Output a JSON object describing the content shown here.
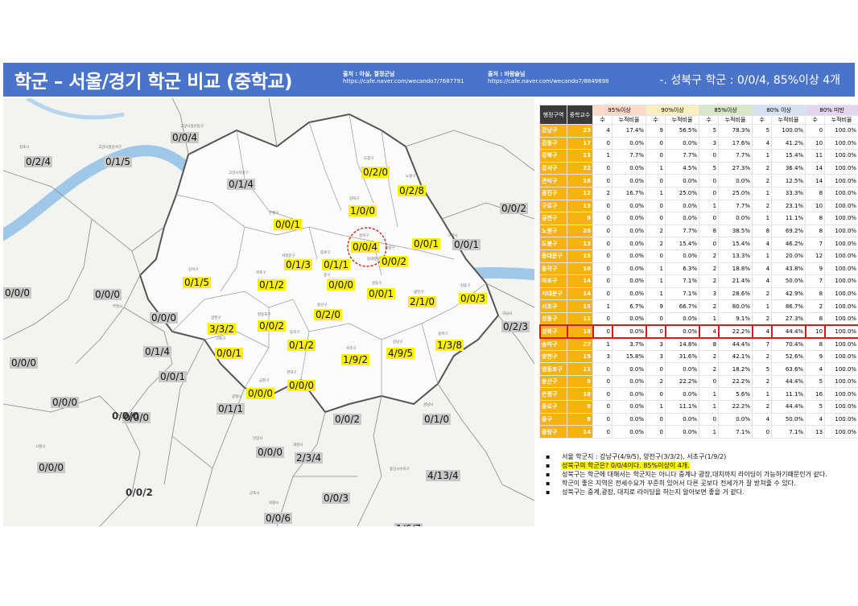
{
  "header": {
    "title": "학군 – 서울/경기 학군 비교 (중학교)",
    "source1_title": "출처 : 아실, 절정군님",
    "source1_url": "https://cafe.naver.com/wecando7/7687791",
    "source2_title": "출처 : 바람술님",
    "source2_url": "https://cafe.naver.com/wecando7/8849898",
    "summary": "-. 성북구 학군 : 0/0/4, 85%이상 4개"
  },
  "colors": {
    "header_bg": "#4a74c9",
    "district_cell": "#f6b20d",
    "label_yellow": "#fff200",
    "label_gray": "#c9c9c9",
    "highlight": "#d41a1a"
  },
  "map": {
    "labels": [
      {
        "text": "0/0/4",
        "style": "g"
      },
      {
        "text": "0/2/4",
        "style": "g"
      },
      {
        "text": "0/1/5",
        "style": "g"
      },
      {
        "text": "0/1/4",
        "style": "g"
      },
      {
        "text": "0/2/0",
        "style": "y"
      },
      {
        "text": "0/2/8",
        "style": "y"
      },
      {
        "text": "1/0/0",
        "style": "y"
      },
      {
        "text": "0/0/2",
        "style": "g"
      },
      {
        "text": "0/0/1",
        "style": "y"
      },
      {
        "text": "0/0/4",
        "style": "y"
      },
      {
        "text": "0/0/1",
        "style": "y"
      },
      {
        "text": "0/0/1",
        "style": "g"
      },
      {
        "text": "0/1/3",
        "style": "y"
      },
      {
        "text": "0/1/1",
        "style": "y"
      },
      {
        "text": "0/0/2",
        "style": "y"
      },
      {
        "text": "0/1/5",
        "style": "y"
      },
      {
        "text": "0/1/2",
        "style": "y"
      },
      {
        "text": "0/0/0",
        "style": "y"
      },
      {
        "text": "0/0/0",
        "style": "g"
      },
      {
        "text": "0/0/0",
        "style": "g"
      },
      {
        "text": "0/0/1",
        "style": "y"
      },
      {
        "text": "2/1/0",
        "style": "y"
      },
      {
        "text": "0/0/3",
        "style": "y"
      },
      {
        "text": "0/0/0",
        "style": "g"
      },
      {
        "text": "3/3/2",
        "style": "y"
      },
      {
        "text": "0/0/2",
        "style": "y"
      },
      {
        "text": "0/2/0",
        "style": "y"
      },
      {
        "text": "0/2/3",
        "style": "g"
      },
      {
        "text": "0/1/4",
        "style": "g"
      },
      {
        "text": "0/0/1",
        "style": "y"
      },
      {
        "text": "0/1/2",
        "style": "y"
      },
      {
        "text": "1/9/2",
        "style": "y"
      },
      {
        "text": "4/9/5",
        "style": "y"
      },
      {
        "text": "1/3/8",
        "style": "y"
      },
      {
        "text": "0/0/0",
        "style": "g"
      },
      {
        "text": "0/0/1",
        "style": "g"
      },
      {
        "text": "0/0/0",
        "style": "y"
      },
      {
        "text": "0/0/0",
        "style": "y"
      },
      {
        "text": "0/0/0",
        "style": "g"
      },
      {
        "text": "0/1/1",
        "style": "g"
      },
      {
        "text": "0/0/0",
        "style": "g"
      },
      {
        "text": "0/0/2",
        "style": "g"
      },
      {
        "text": "0/1/0",
        "style": "g"
      },
      {
        "text": "0/0/0",
        "style": "g"
      },
      {
        "text": "0/0/0",
        "style": "g"
      },
      {
        "text": "2/3/4",
        "style": "g"
      },
      {
        "text": "0/0/0",
        "style": "w"
      },
      {
        "text": "4/13/4",
        "style": "g"
      },
      {
        "text": "0/0/2",
        "style": "w"
      },
      {
        "text": "0/0/3",
        "style": "g"
      },
      {
        "text": "0/0/6",
        "style": "g"
      },
      {
        "text": "1/6/7",
        "style": "g"
      }
    ],
    "small_names": [
      "고양시일산동구",
      "김포시",
      "고양시일산서구",
      "고양시덕양구",
      "도봉구",
      "노원구",
      "강북구",
      "은평구",
      "성북구",
      "중랑구",
      "구리시",
      "서대문구",
      "종로구",
      "동대문구",
      "강서구",
      "마포구",
      "중구",
      "성동구",
      "광진구",
      "부천시",
      "양천구",
      "영등포구",
      "용산구",
      "강동구",
      "하남시",
      "구로구",
      "동작구",
      "서초구",
      "강남구",
      "송파구",
      "금천구",
      "관악구",
      "광명시",
      "시흥시",
      "안양시",
      "과천시",
      "성남시",
      "의왕시",
      "군포시",
      "용인시수지구"
    ]
  },
  "table": {
    "col_district": "행정구역",
    "col_schools": "중학교수",
    "groups": [
      "95%이상",
      "90%이상",
      "85%이상",
      "80% 이상",
      "80% 미만"
    ],
    "sub_count": "수",
    "sub_ratio": "누적비율",
    "rows": [
      {
        "d": "강남구",
        "n": "23",
        "v": [
          "4",
          "17.4%",
          "9",
          "56.5%",
          "5",
          "78.3%",
          "5",
          "100.0%",
          "0",
          "100.0%"
        ]
      },
      {
        "d": "강동구",
        "n": "17",
        "v": [
          "0",
          "0.0%",
          "0",
          "0.0%",
          "3",
          "17.6%",
          "4",
          "41.2%",
          "10",
          "100.0%"
        ]
      },
      {
        "d": "강북구",
        "n": "13",
        "v": [
          "1",
          "7.7%",
          "0",
          "7.7%",
          "0",
          "7.7%",
          "1",
          "15.4%",
          "11",
          "100.0%"
        ]
      },
      {
        "d": "강서구",
        "n": "22",
        "v": [
          "0",
          "0.0%",
          "1",
          "4.5%",
          "5",
          "27.3%",
          "2",
          "36.4%",
          "14",
          "100.0%"
        ]
      },
      {
        "d": "관악구",
        "n": "16",
        "v": [
          "0",
          "0.0%",
          "0",
          "0.0%",
          "0",
          "0.0%",
          "2",
          "12.5%",
          "14",
          "100.0%"
        ]
      },
      {
        "d": "광진구",
        "n": "12",
        "v": [
          "2",
          "16.7%",
          "1",
          "25.0%",
          "0",
          "25.0%",
          "1",
          "33.3%",
          "8",
          "100.0%"
        ]
      },
      {
        "d": "구로구",
        "n": "13",
        "v": [
          "0",
          "0.0%",
          "0",
          "0.0%",
          "1",
          "7.7%",
          "2",
          "23.1%",
          "10",
          "100.0%"
        ]
      },
      {
        "d": "금천구",
        "n": "9",
        "v": [
          "0",
          "0.0%",
          "0",
          "0.0%",
          "0",
          "0.0%",
          "1",
          "11.1%",
          "8",
          "100.0%"
        ]
      },
      {
        "d": "노원구",
        "n": "26",
        "v": [
          "0",
          "0.0%",
          "2",
          "7.7%",
          "8",
          "38.5%",
          "8",
          "69.2%",
          "8",
          "100.0%"
        ]
      },
      {
        "d": "도봉구",
        "n": "13",
        "v": [
          "0",
          "0.0%",
          "2",
          "15.4%",
          "0",
          "15.4%",
          "4",
          "46.2%",
          "7",
          "100.0%"
        ]
      },
      {
        "d": "동대문구",
        "n": "15",
        "v": [
          "0",
          "0.0%",
          "0",
          "0.0%",
          "2",
          "13.3%",
          "1",
          "20.0%",
          "12",
          "100.0%"
        ]
      },
      {
        "d": "동작구",
        "n": "16",
        "v": [
          "0",
          "0.0%",
          "1",
          "6.3%",
          "2",
          "18.8%",
          "4",
          "43.8%",
          "9",
          "100.0%"
        ]
      },
      {
        "d": "마포구",
        "n": "14",
        "v": [
          "0",
          "0.0%",
          "1",
          "7.1%",
          "2",
          "21.4%",
          "4",
          "50.0%",
          "7",
          "100.0%"
        ]
      },
      {
        "d": "서대문구",
        "n": "14",
        "v": [
          "0",
          "0.0%",
          "1",
          "7.1%",
          "3",
          "28.6%",
          "2",
          "42.9%",
          "8",
          "100.0%"
        ]
      },
      {
        "d": "서초구",
        "n": "15",
        "v": [
          "1",
          "6.7%",
          "9",
          "66.7%",
          "2",
          "80.0%",
          "1",
          "86.7%",
          "2",
          "100.0%"
        ]
      },
      {
        "d": "성동구",
        "n": "11",
        "v": [
          "0",
          "0.0%",
          "0",
          "0.0%",
          "1",
          "9.1%",
          "2",
          "27.3%",
          "8",
          "100.0%"
        ]
      },
      {
        "d": "성북구",
        "n": "18",
        "v": [
          "0",
          "0.0%",
          "0",
          "0.0%",
          "4",
          "22.2%",
          "4",
          "44.4%",
          "10",
          "100.0%"
        ],
        "highlight": true
      },
      {
        "d": "송파구",
        "n": "27",
        "v": [
          "1",
          "3.7%",
          "3",
          "14.8%",
          "8",
          "44.4%",
          "7",
          "70.4%",
          "8",
          "100.0%"
        ]
      },
      {
        "d": "양천구",
        "n": "19",
        "v": [
          "3",
          "15.8%",
          "3",
          "31.6%",
          "2",
          "42.1%",
          "2",
          "52.6%",
          "9",
          "100.0%"
        ]
      },
      {
        "d": "영등포구",
        "n": "11",
        "v": [
          "0",
          "0.0%",
          "0",
          "0.0%",
          "2",
          "18.2%",
          "5",
          "63.6%",
          "4",
          "100.0%"
        ]
      },
      {
        "d": "용산구",
        "n": "9",
        "v": [
          "0",
          "0.0%",
          "2",
          "22.2%",
          "0",
          "22.2%",
          "2",
          "44.4%",
          "5",
          "100.0%"
        ]
      },
      {
        "d": "은평구",
        "n": "18",
        "v": [
          "0",
          "0.0%",
          "0",
          "0.0%",
          "1",
          "5.6%",
          "1",
          "11.1%",
          "16",
          "100.0%"
        ]
      },
      {
        "d": "종로구",
        "n": "9",
        "v": [
          "0",
          "0.0%",
          "1",
          "11.1%",
          "1",
          "22.2%",
          "2",
          "44.4%",
          "5",
          "100.0%"
        ]
      },
      {
        "d": "중구",
        "n": "8",
        "v": [
          "0",
          "0.0%",
          "0",
          "0.0%",
          "0",
          "0.0%",
          "4",
          "50.0%",
          "4",
          "100.0%"
        ]
      },
      {
        "d": "중랑구",
        "n": "14",
        "v": [
          "0",
          "0.0%",
          "0",
          "0.0%",
          "1",
          "7.1%",
          "0",
          "7.1%",
          "13",
          "100.0%"
        ]
      }
    ]
  },
  "notes": [
    {
      "text": "서울 학군지 : 강남구(4/9/5), 양천구(3/3/2), 서초구(1/9/2)",
      "mark": false
    },
    {
      "text": "성북구의 학군은? 0/0/4이다. 85%이상이 4개.",
      "mark": true
    },
    {
      "text": "성북구는 학군에 대해서는 학군지는 아니다 중계나 광장,대치까지 라이딩이 가능하기때문인거 같다.",
      "mark": false
    },
    {
      "text": "학군이 좋은 지역은 전세수요가 꾸준히 있어서 다른 곳보다 전세가가 잘 받쳐줄 수 있다.",
      "mark": false
    },
    {
      "text": "성북구는 중계,광장, 대치로 라이딩을 하는지 알아보면 좋을 거 같다.",
      "mark": false
    }
  ]
}
